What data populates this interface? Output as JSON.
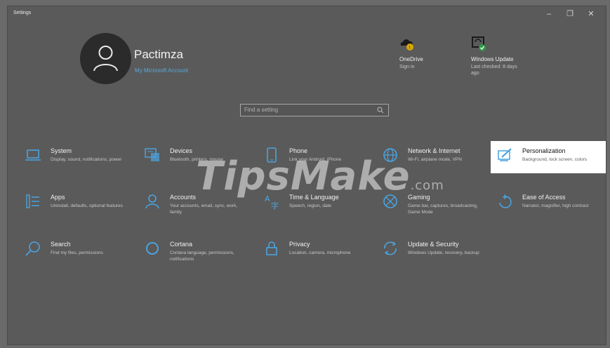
{
  "window": {
    "title": "Settings",
    "controls": {
      "minimize": "–",
      "restore": "❐",
      "close": "✕"
    }
  },
  "profile": {
    "name": "Pactimza",
    "account_link": "My Microsoft Account"
  },
  "quick_links": [
    {
      "title": "OneDrive",
      "subtitle": "Sign in",
      "icon": "onedrive-icon"
    },
    {
      "title": "Windows Update",
      "subtitle": "Last checked: 8 days ago",
      "icon": "windows-update-icon"
    }
  ],
  "search": {
    "placeholder": "Find a setting"
  },
  "categories": [
    {
      "title": "System",
      "desc": "Display, sound, notifications, power",
      "icon": "laptop-icon"
    },
    {
      "title": "Devices",
      "desc": "Bluetooth, printers, mouse",
      "icon": "keyboard-icon"
    },
    {
      "title": "Phone",
      "desc": "Link your Android, iPhone",
      "icon": "phone-icon"
    },
    {
      "title": "Network & Internet",
      "desc": "Wi-Fi, airplane mode, VPN",
      "icon": "globe-icon"
    },
    {
      "title": "Personalization",
      "desc": "Background, lock screen, colors",
      "icon": "paintbrush-icon"
    },
    {
      "title": "Apps",
      "desc": "Uninstall, defaults, optional features",
      "icon": "apps-list-icon"
    },
    {
      "title": "Accounts",
      "desc": "Your accounts, email, sync, work, family",
      "icon": "person-icon"
    },
    {
      "title": "Time & Language",
      "desc": "Speech, region, date",
      "icon": "language-icon"
    },
    {
      "title": "Gaming",
      "desc": "Game bar, captures, broadcasting, Game Mode",
      "icon": "xbox-icon"
    },
    {
      "title": "Ease of Access",
      "desc": "Narrator, magnifier, high contrast",
      "icon": "ease-of-access-icon"
    },
    {
      "title": "Search",
      "desc": "Find my files, permissions",
      "icon": "search-icon"
    },
    {
      "title": "Cortana",
      "desc": "Cortana language, permissions, notifications",
      "icon": "cortana-icon"
    },
    {
      "title": "Privacy",
      "desc": "Location, camera, microphone",
      "icon": "lock-icon"
    },
    {
      "title": "Update & Security",
      "desc": "Windows Update, recovery, backup",
      "icon": "sync-icon"
    }
  ],
  "watermark": {
    "main": "TipsMake",
    "suffix": ".com"
  },
  "colors": {
    "accent_link": "#5aa7d8",
    "icon_blue": "#4aa3df",
    "highlight_bg": "#ffffff"
  }
}
